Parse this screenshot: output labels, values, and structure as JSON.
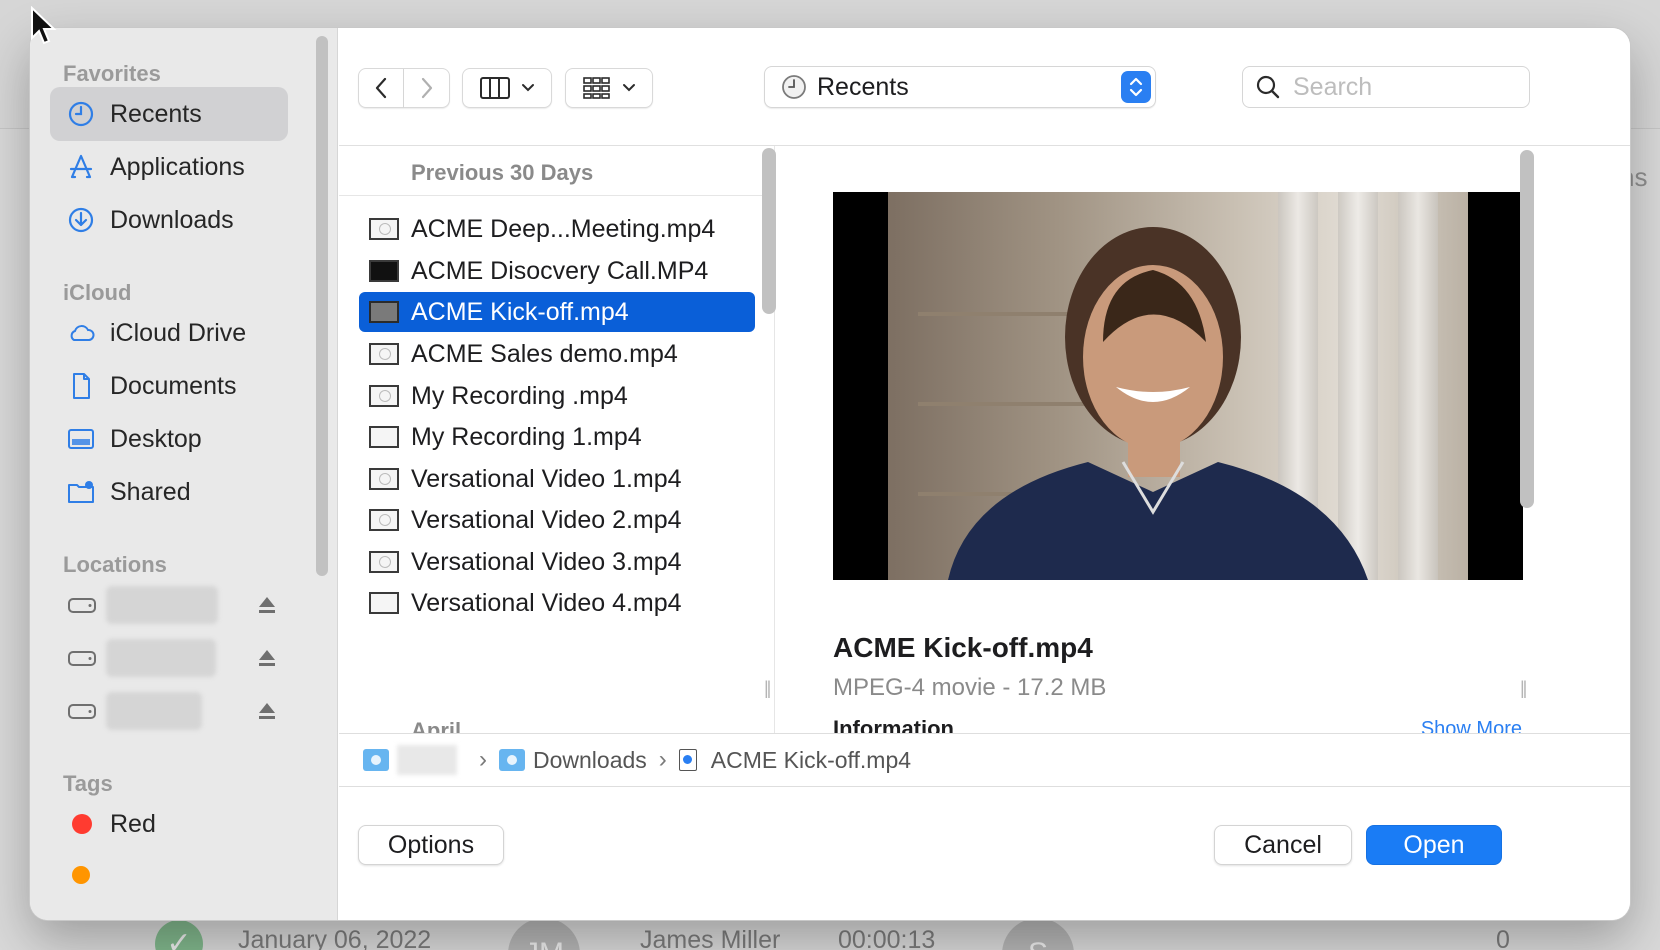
{
  "sidebar": {
    "favorites_heading": "Favorites",
    "favorites": [
      {
        "label": "Recents",
        "icon": "clock-icon"
      },
      {
        "label": "Applications",
        "icon": "apps-icon"
      },
      {
        "label": "Downloads",
        "icon": "download-icon"
      }
    ],
    "icloud_heading": "iCloud",
    "icloud": [
      {
        "label": "iCloud Drive",
        "icon": "cloud-icon"
      },
      {
        "label": "Documents",
        "icon": "document-icon"
      },
      {
        "label": "Desktop",
        "icon": "desktop-icon"
      },
      {
        "label": "Shared",
        "icon": "shared-folder-icon"
      }
    ],
    "locations_heading": "Locations",
    "tags_heading": "Tags",
    "tags": [
      {
        "label": "Red",
        "color": "#ff3b30"
      }
    ]
  },
  "toolbar": {
    "location": "Recents",
    "search_placeholder": "Search"
  },
  "files": {
    "section": "Previous 30 Days",
    "items": [
      "ACME Deep...Meeting.mp4",
      "ACME Disocvery Call.MP4",
      "ACME Kick-off.mp4",
      "ACME Sales demo.mp4",
      "My Recording .mp4",
      "My Recording 1.mp4",
      "Versational Video 1.mp4",
      "Versational Video 2.mp4",
      "Versational Video 3.mp4",
      "Versational Video 4.mp4"
    ],
    "selected_index": 2,
    "next_section": "April"
  },
  "preview": {
    "title": "ACME Kick-off.mp4",
    "subtitle": "MPEG-4 movie - 17.2 MB",
    "info_heading": "Information",
    "show_more": "Show More"
  },
  "pathbar": {
    "folder": "Downloads",
    "file": "ACME Kick-off.mp4"
  },
  "buttons": {
    "options": "Options",
    "cancel": "Cancel",
    "open": "Open"
  },
  "background": {
    "side_text": "ns",
    "row_date": "January 06, 2022",
    "row_initials": "JM",
    "row_name": "James Miller",
    "row_duration": "00:00:13",
    "row_initial2": "S",
    "row_count": "0"
  },
  "colors": {
    "accent": "#1a7cf5",
    "selection": "#0a5fd8"
  }
}
